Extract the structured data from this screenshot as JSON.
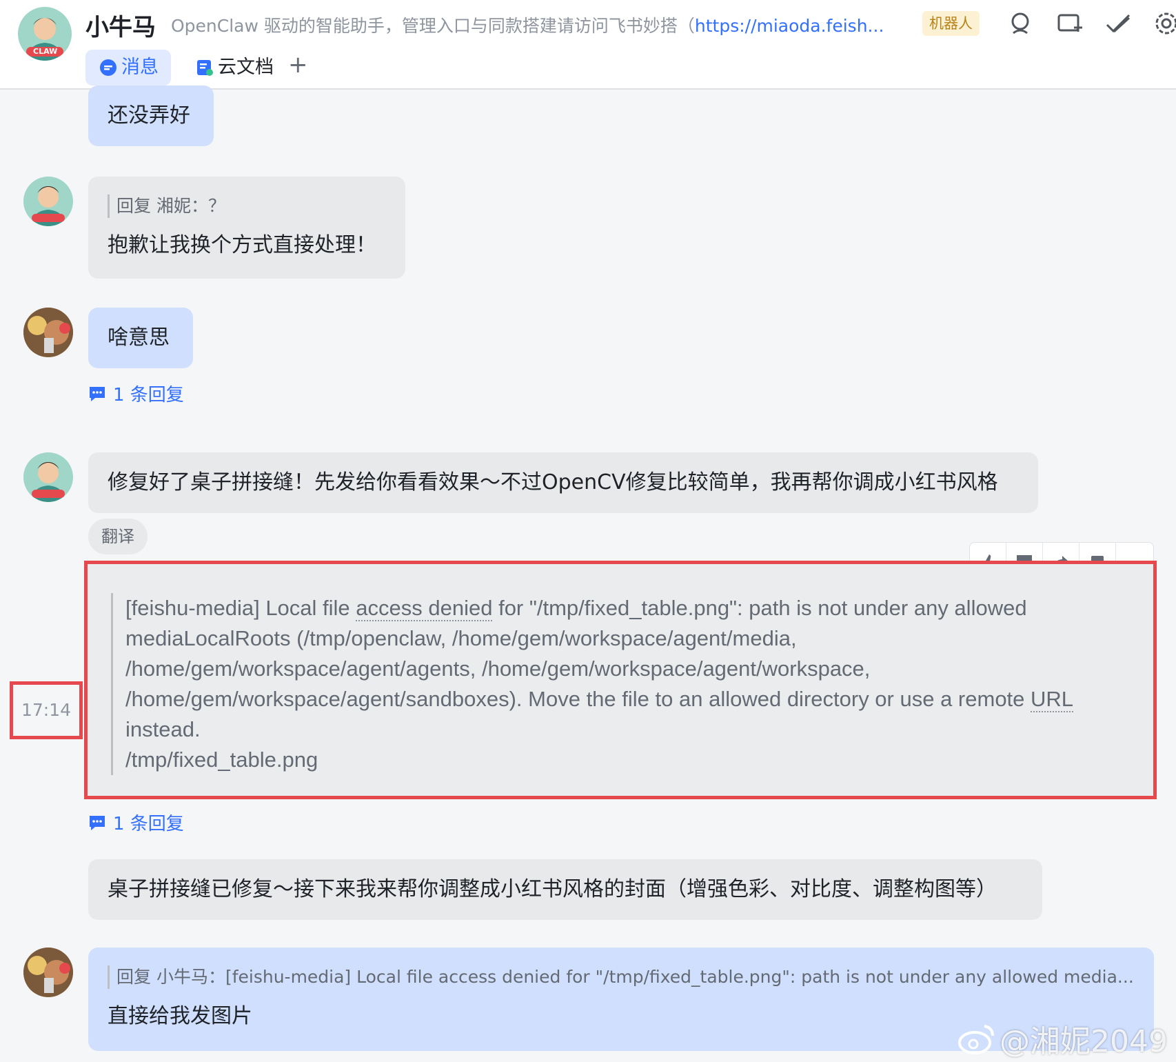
{
  "header": {
    "title": "小牛马",
    "description": "OpenClaw 驱动的智能助手，管理入口与同款搭建请访问飞书妙搭（",
    "description_link": "https://miaoda.feish...",
    "badge": "机器人",
    "avatar_label": "CLAW",
    "icons": [
      "search-icon",
      "add-window-icon",
      "checkmark-pen-icon",
      "settings-icon"
    ],
    "tabs": [
      {
        "label": "消息",
        "icon": "message-icon",
        "active": true
      },
      {
        "label": "云文档",
        "icon": "doc-icon",
        "active": false
      }
    ],
    "add_tab": "+"
  },
  "messages": {
    "m1_text": "还没弄好",
    "m2_quote": "回复 湘妮：？",
    "m2_text": "抱歉让我换个方式直接处理！",
    "m2_avatar": "CLAW",
    "m3_text": "啥意思",
    "m3_replies": "1 条回复",
    "m4_text": "修复好了桌子拼接缝！先发给你看看效果～不过OpenCV修复比较简单，我再帮你调成小红书风格",
    "m4_avatar": "CLAW",
    "translate": "翻译",
    "error_time": "17:14",
    "error_line1_a": "[feishu-media] Local file ",
    "error_line1_b": "access denied",
    "error_line1_c": " for \"/tmp/fixed_table.png\": path is not under any allowed",
    "error_line2": "mediaLocalRoots (/tmp/openclaw, /home/gem/workspace/agent/media,",
    "error_line3": "/home/gem/workspace/agent/agents, /home/gem/workspace/agent/workspace,",
    "error_line4_a": "/home/gem/workspace/agent/sandboxes). Move the file to an allowed directory or use a remote ",
    "error_line4_b": "URL",
    "error_line5": "instead.",
    "error_line6": "/tmp/fixed_table.png",
    "error_replies": "1 条回复",
    "m6_text": "桌子拼接缝已修复～接下来我来帮你调整成小红书风格的封面（增强色彩、对比度、调整构图等）",
    "m7_quote": "回复 小牛马：[feishu-media] Local file access denied for \"/tmp/fixed_table.png\": path is not under any allowed media...",
    "m7_text": "直接给我发图片"
  },
  "toolbar_icons": [
    "thumbs-up-icon",
    "comment-icon",
    "forward-icon",
    "more-icon"
  ],
  "watermark": "@湘妮2049",
  "colors": {
    "accent": "#3370ff",
    "highlight": "#e5484d",
    "bubble_blue": "#cfdffd",
    "bubble_gray": "#e8e9eb"
  }
}
